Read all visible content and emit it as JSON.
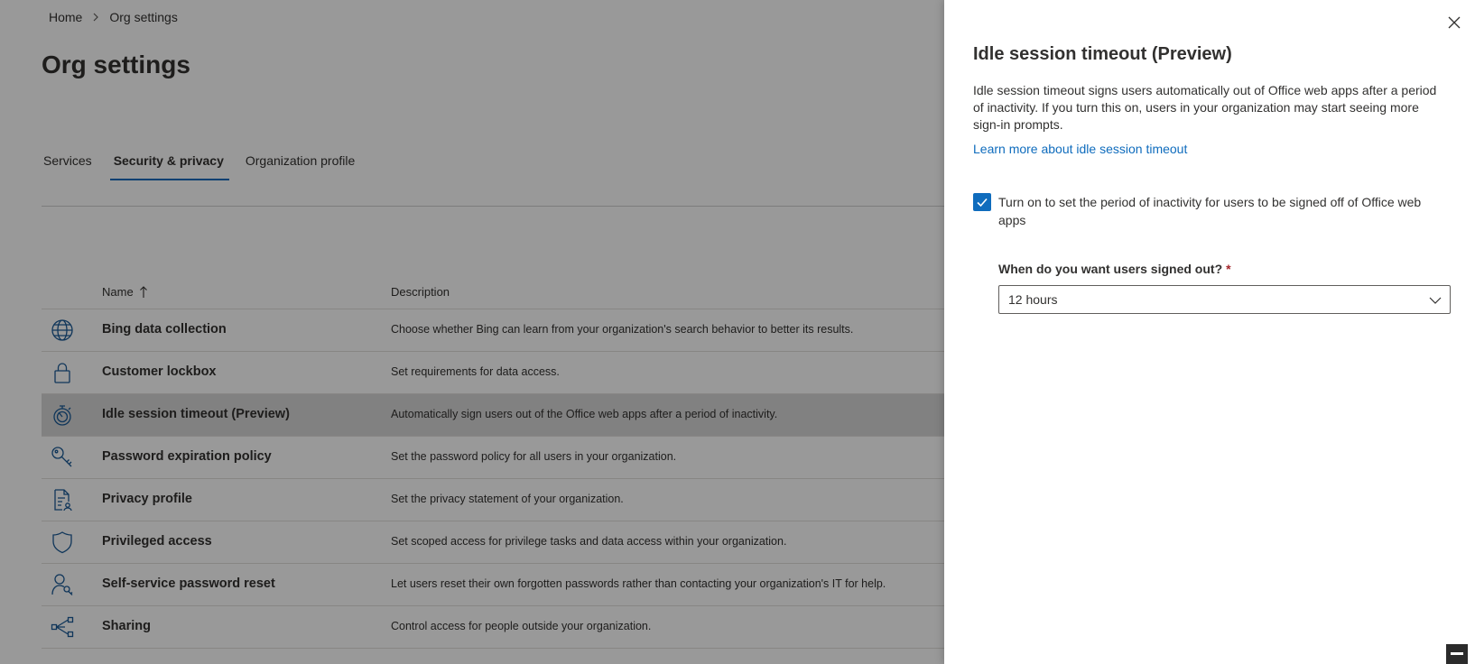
{
  "breadcrumb": {
    "home": "Home",
    "current": "Org settings"
  },
  "page": {
    "title": "Org settings"
  },
  "tabs": [
    {
      "label": "Services"
    },
    {
      "label": "Security & privacy"
    },
    {
      "label": "Organization profile"
    }
  ],
  "table": {
    "headers": {
      "name": "Name",
      "description": "Description"
    },
    "rows": [
      {
        "icon": "globe-icon",
        "name": "Bing data collection",
        "description": "Choose whether Bing can learn from your organization's search behavior to better its results."
      },
      {
        "icon": "lock-icon",
        "name": "Customer lockbox",
        "description": "Set requirements for data access."
      },
      {
        "icon": "stopwatch-icon",
        "name": "Idle session timeout (Preview)",
        "description": "Automatically sign users out of the Office web apps after a period of inactivity."
      },
      {
        "icon": "key-icon",
        "name": "Password expiration policy",
        "description": "Set the password policy for all users in your organization."
      },
      {
        "icon": "document-person-icon",
        "name": "Privacy profile",
        "description": "Set the privacy statement of your organization."
      },
      {
        "icon": "shield-icon",
        "name": "Privileged access",
        "description": "Set scoped access for privilege tasks and data access within your organization."
      },
      {
        "icon": "person-key-icon",
        "name": "Self-service password reset",
        "description": "Let users reset their own forgotten passwords rather than contacting your organization's IT for help."
      },
      {
        "icon": "share-icon",
        "name": "Sharing",
        "description": "Control access for people outside your organization."
      }
    ]
  },
  "panel": {
    "title": "Idle session timeout (Preview)",
    "description": "Idle session timeout signs users automatically out of Office web apps after a period of inactivity. If you turn this on, users in your organization may start seeing more sign-in prompts.",
    "link": "Learn more about idle session timeout",
    "checkbox_label": "Turn on to set the period of inactivity for users to be signed off of Office web apps",
    "checkbox_checked": true,
    "field_label": "When do you want users signed out?",
    "required_mark": "*",
    "select_value": "12 hours"
  },
  "colors": {
    "accent": "#0f6cbd",
    "required": "#a4262c",
    "icon": "#1b5a96"
  }
}
